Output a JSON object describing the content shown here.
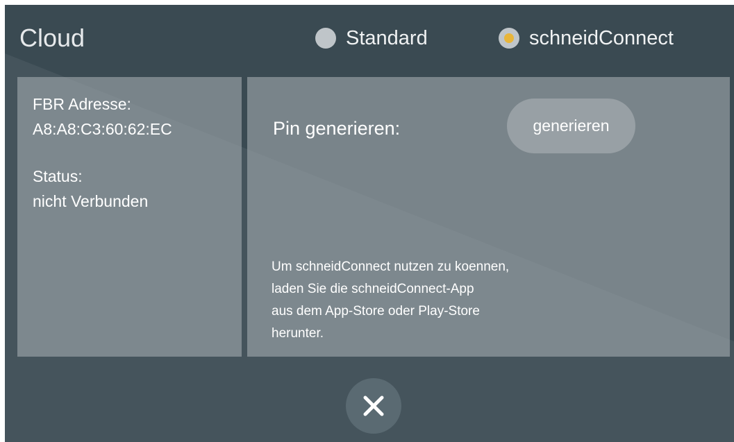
{
  "header": {
    "title": "Cloud",
    "radio_options": [
      {
        "label": "Standard",
        "selected": false
      },
      {
        "label": "schneidConnect",
        "selected": true
      }
    ]
  },
  "info_panel": {
    "address_label": "FBR Adresse:",
    "address_value": "A8:A8:C3:60:62:EC",
    "status_label": "Status:",
    "status_value": "nicht Verbunden"
  },
  "pin_panel": {
    "label": "Pin generieren:",
    "button_label": "generieren",
    "hint_lines": [
      "Um schneidConnect nutzen zu koennen,",
      "laden Sie die schneidConnect-App",
      "aus dem App-Store oder Play-Store",
      "herunter."
    ]
  },
  "footer": {
    "close_icon": "close-icon"
  },
  "colors": {
    "background": "#3a4a52",
    "panel": "#8d969b",
    "radio_unselected": "#bfc5c9",
    "radio_selected_dot": "#e8b53a",
    "close_button": "#5a6a72"
  }
}
